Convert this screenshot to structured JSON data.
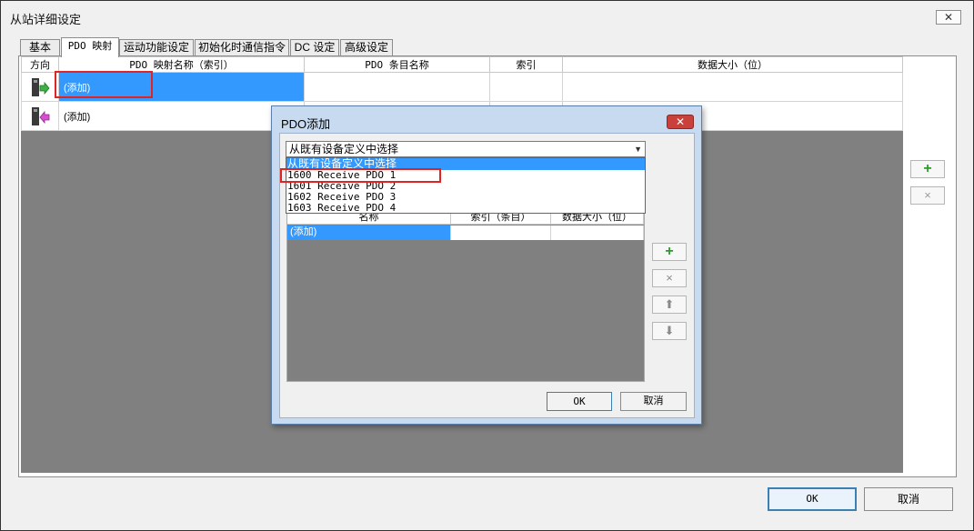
{
  "window": {
    "title": "从站详细设定",
    "close": "✕"
  },
  "tabs": [
    "基本",
    "PDO 映射",
    "运动功能设定",
    "初始化时通信指令",
    "DC 设定",
    "高级设定"
  ],
  "grid": {
    "headers": [
      "方向",
      "PDO 映射名称（索引）",
      "PDO 条目名称",
      "索引",
      "数据大小（位）"
    ],
    "rows": [
      {
        "direction_icon": "output-arrow-icon",
        "name": "(添加)"
      },
      {
        "direction_icon": "input-arrow-icon",
        "name": "(添加)"
      }
    ]
  },
  "side_buttons": {
    "add": "+",
    "delete": "×"
  },
  "bottom": {
    "ok": "OK",
    "cancel": "取消"
  },
  "dialog": {
    "title": "PDO添加",
    "close": "✕",
    "combo_value": "从既有设备定义中选择",
    "dropdown_items": [
      "从既有设备定义中选择",
      "1600 Receive PDO 1",
      "1601 Receive PDO 2",
      "1602 Receive PDO 3",
      "1603 Receive PDO 4"
    ],
    "grid_headers": [
      "名称",
      "索引（条目）",
      "数据大小（位）"
    ],
    "grid_row": "(添加)",
    "buttons": {
      "add": "+",
      "delete": "×",
      "up": "⬆",
      "down": "⬇",
      "ok": "OK",
      "cancel": "取消"
    }
  },
  "colors": {
    "selection": "#3399ff",
    "highlight_box": "#e02424",
    "grid_empty": "#808080",
    "add_icon": "#2e9a2e"
  }
}
